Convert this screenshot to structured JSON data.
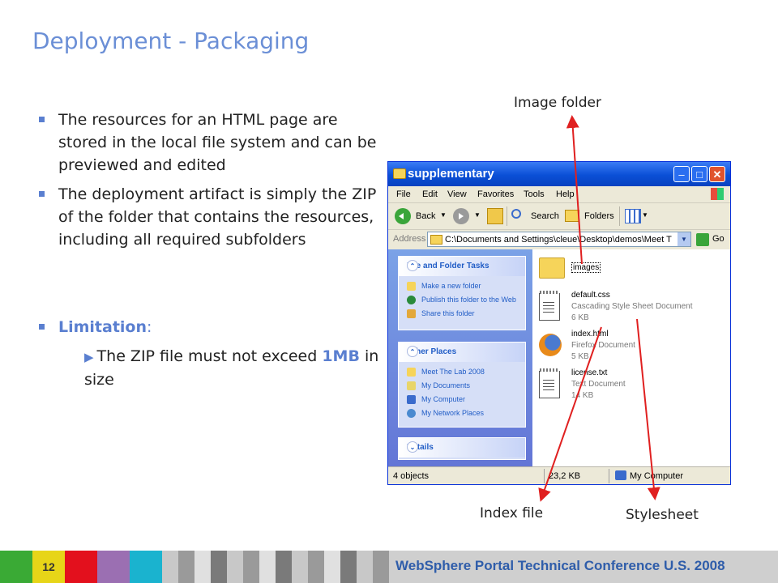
{
  "slide": {
    "title": "Deployment - Packaging",
    "bullets": [
      "The resources for an HTML page are stored in the local file system and can be previewed and edited",
      "The deployment artifact is simply the ZIP of the folder that contains the resources, including all required subfolders"
    ],
    "limitation": {
      "title": "Limitation",
      "colon": ":",
      "sub_prefix": "The ZIP file must not exceed",
      "size": "1MB",
      "sub_suffix": "in size"
    },
    "callouts": {
      "image_folder": "Image folder",
      "index_file": "Index file",
      "stylesheet": "Stylesheet"
    }
  },
  "explorer": {
    "title": "supplementary",
    "menu": [
      "File",
      "Edit",
      "View",
      "Favorites",
      "Tools",
      "Help"
    ],
    "toolbar": {
      "back": "Back",
      "search": "Search",
      "folders": "Folders"
    },
    "address": {
      "label": "Address",
      "path": "C:\\Documents and Settings\\cleue\\Desktop\\demos\\Meet The",
      "go": "Go"
    },
    "file_tasks": {
      "header": "File and Folder Tasks",
      "items": [
        "Make a new folder",
        "Publish this folder to the Web",
        "Share this folder"
      ]
    },
    "other_places": {
      "header": "Other Places",
      "items": [
        "Meet The Lab 2008",
        "My Documents",
        "My Computer",
        "My Network Places"
      ]
    },
    "details": {
      "header": "Details"
    },
    "files": [
      {
        "name": "images",
        "type": "",
        "size": "",
        "icon": "folder-icon"
      },
      {
        "name": "default.css",
        "type": "Cascading Style Sheet Document",
        "size": "6 KB",
        "icon": "document-icon"
      },
      {
        "name": "index.html",
        "type": "Firefox Document",
        "size": "5 KB",
        "icon": "firefox-icon"
      },
      {
        "name": "license.txt",
        "type": "Text Document",
        "size": "14 KB",
        "icon": "document-icon"
      }
    ],
    "status": {
      "objects": "4 objects",
      "size": "23,2 KB",
      "location": "My Computer"
    }
  },
  "footer": {
    "page_number": "12",
    "conference": "WebSphere Portal Technical Conference U.S. 2008",
    "colors": {
      "green": "#3aaa35",
      "yellow": "#e7d518",
      "red": "#e3101d",
      "purple": "#9b6fb2",
      "cyan": "#1ab3cf",
      "gray": "#b0b0b0"
    }
  }
}
